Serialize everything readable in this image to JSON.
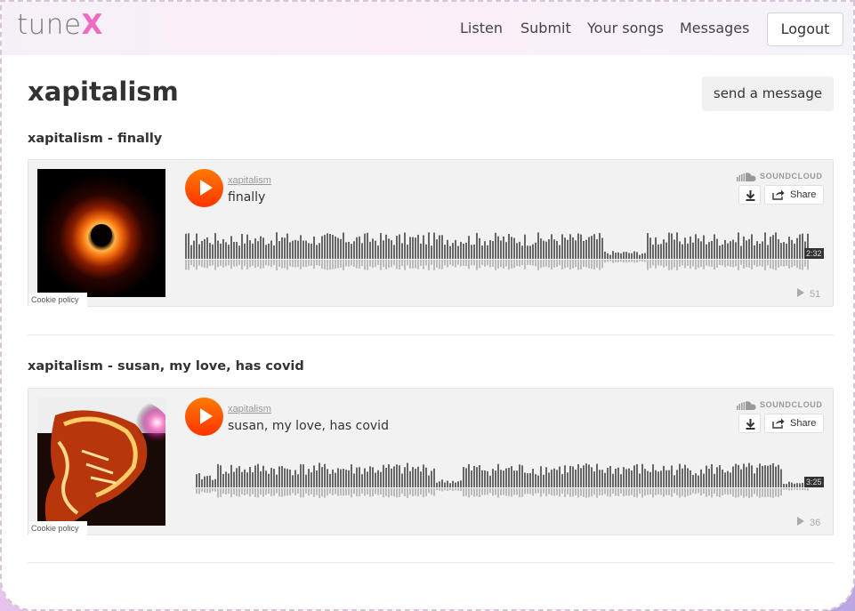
{
  "app": {
    "logo_text": "tune",
    "logo_accent": "X"
  },
  "nav": {
    "items": [
      {
        "label": "Listen"
      },
      {
        "label": "Submit"
      },
      {
        "label": "Your songs"
      },
      {
        "label": "Messages"
      }
    ],
    "logout_label": "Logout"
  },
  "profile": {
    "artist_name": "xapitalism",
    "send_message_label": "send a message"
  },
  "songs": [
    {
      "heading": "xapitalism - finally",
      "player": {
        "artist": "xapitalism",
        "track": "finally",
        "brand": "SOUNDCLOUD",
        "share_label": "Share",
        "duration": "2:32",
        "plays": "51",
        "cookie_label": "Cookie policy"
      }
    },
    {
      "heading": "xapitalism - susan, my love, has covid",
      "player": {
        "artist": "xapitalism",
        "track": "susan, my love, has covid",
        "brand": "SOUNDCLOUD",
        "share_label": "Share",
        "duration": "3:25",
        "plays": "36",
        "cookie_label": "Cookie policy"
      }
    }
  ],
  "colors": {
    "accent": "#f06ac3",
    "play_button": "#ff5500"
  }
}
